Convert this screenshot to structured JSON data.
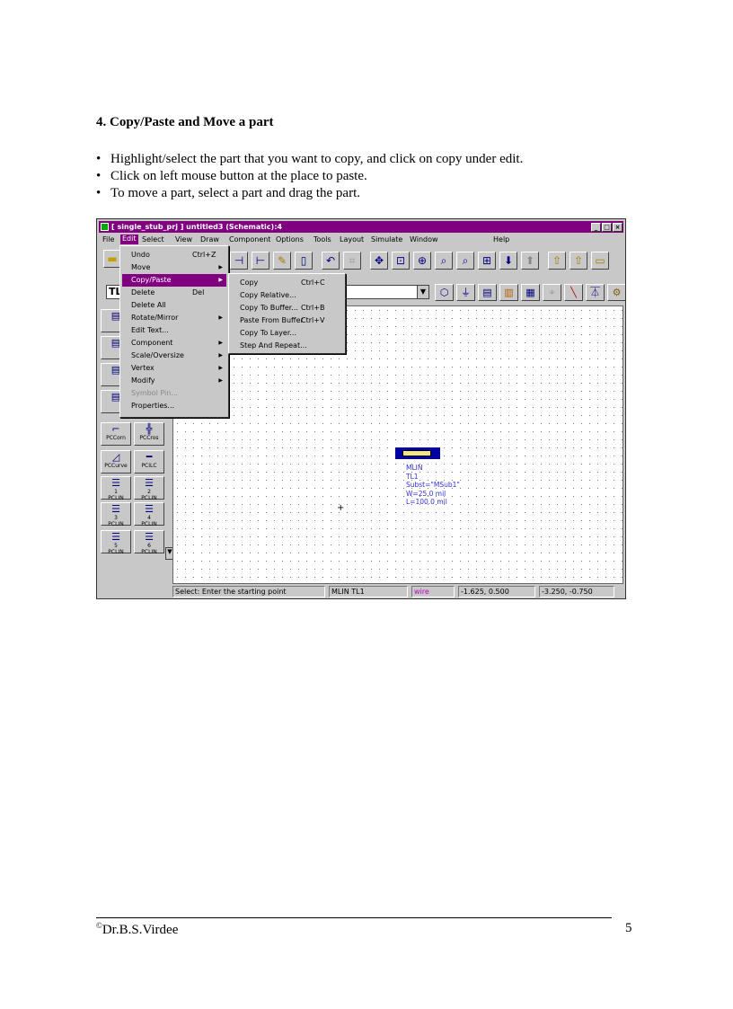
{
  "heading": "4. Copy/Paste and Move a part",
  "bullets": [
    "Highlight/select the part that you want to copy, and click on copy under edit.",
    "Click on left mouse button at the place to paste.",
    "To move a part, select a part and drag the part."
  ],
  "window": {
    "title": "[ single_stub_prj ] untitled3 (Schematic):4",
    "menus": [
      "File",
      "Edit",
      "Select",
      "View",
      "Draw",
      "Component",
      "Options",
      "Tools",
      "Layout",
      "Simulate",
      "Window",
      "Help"
    ],
    "toolbar_field": "TL",
    "edit_menu": [
      {
        "label": "Undo",
        "shortcut": "Ctrl+Z"
      },
      {
        "label": "Move",
        "shortcut": "",
        "submenu": true
      },
      {
        "label": "Copy/Paste",
        "shortcut": "",
        "submenu": true
      },
      {
        "label": "Delete",
        "shortcut": "Del"
      },
      {
        "label": "Delete All",
        "shortcut": ""
      },
      {
        "label": "Rotate/Mirror",
        "shortcut": "",
        "submenu": true
      },
      {
        "label": "Edit Text...",
        "shortcut": ""
      },
      {
        "label": "Component",
        "shortcut": "",
        "submenu": true
      },
      {
        "label": "Scale/Oversize",
        "shortcut": "",
        "submenu": true
      },
      {
        "label": "Vertex",
        "shortcut": "",
        "submenu": true
      },
      {
        "label": "Modify",
        "shortcut": "",
        "submenu": true
      },
      {
        "label": "Symbol Pin...",
        "shortcut": ""
      },
      {
        "label": "Properties...",
        "shortcut": ""
      }
    ],
    "copy_submenu": [
      {
        "label": "Copy",
        "shortcut": "Ctrl+C"
      },
      {
        "label": "Copy Relative...",
        "shortcut": ""
      },
      {
        "label": "Copy To Buffer...",
        "shortcut": "Ctrl+B"
      },
      {
        "label": "Paste From Buffer",
        "shortcut": "Ctrl+V"
      },
      {
        "label": "Copy To Layer...",
        "shortcut": ""
      },
      {
        "label": "Step And Repeat...",
        "shortcut": ""
      }
    ],
    "palette": [
      "PCCorn",
      "PCCros",
      "PCCurve",
      "PCILC",
      "PCLIN",
      "PCLIN",
      "PCLIN",
      "PCLIN",
      "PCLIN",
      "PCLIN"
    ],
    "palette_nums": [
      "",
      "",
      "",
      "",
      "1",
      "2",
      "3",
      "4",
      "5",
      "6"
    ],
    "part_labels": [
      "MLIN",
      "TL1",
      "Subst=\"MSub1\"",
      "W=25.0 mil",
      "L=100.0 mil"
    ],
    "status": [
      "Select: Enter the starting point",
      "MLIN TL1",
      "wire",
      "-1.625, 0.500",
      "-3.250, -0.750"
    ]
  },
  "footer": {
    "author": "Dr.B.S.Virdee",
    "copyright": "©",
    "page": "5"
  }
}
